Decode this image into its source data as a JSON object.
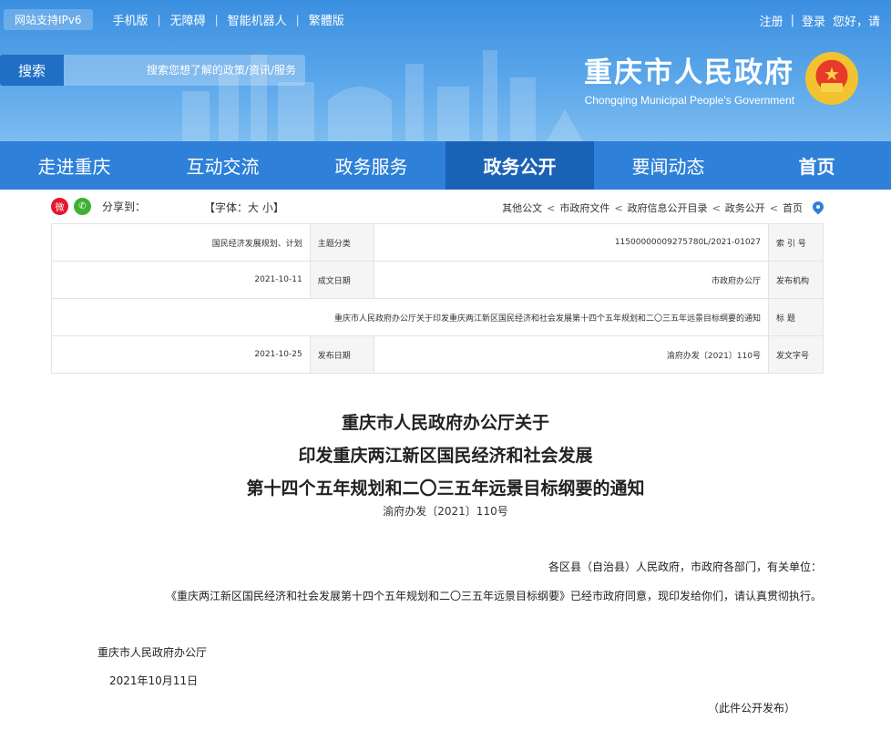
{
  "topbar": {
    "ipv6": "网站支持IPv6",
    "links": [
      "手机版",
      "无障碍",
      "智能机器人",
      "繁體版"
    ],
    "greeting": "您好，请",
    "login": "登录",
    "register": "注册"
  },
  "search": {
    "button": "搜索",
    "placeholder": "搜索您想了解的政策/资讯/服务"
  },
  "logo": {
    "title": "重庆市人民政府",
    "subtitle": "Chongqing Municipal People's Government"
  },
  "nav": {
    "items": [
      "首页",
      "要闻动态",
      "政务公开",
      "政务服务",
      "互动交流",
      "走进重庆"
    ]
  },
  "share": {
    "label": "分享到：",
    "font_size": "【字体：",
    "font_small": "小",
    "font_large": "大",
    "font_close": "】"
  },
  "breadcrumb": [
    "首页",
    "政务公开",
    "政府信息公开目录",
    "市政府文件",
    "其他公文"
  ],
  "meta": {
    "index_label": "索 引 号",
    "index_value": "11500000009275780L/2021-01027",
    "category_label": "主题分类",
    "category_value": "国民经济发展规划、计划",
    "issuer_label": "发布机构",
    "issuer_value": "市政府办公厅",
    "written_label": "成文日期",
    "written_value": "2021-10-11",
    "title_label": "标 题",
    "title_value": "重庆市人民政府办公厅关于印发重庆两江新区国民经济和社会发展第十四个五年规划和二〇三五年远景目标纲要的通知",
    "docno_label": "发文字号",
    "docno_value": "渝府办发〔2021〕110号",
    "published_label": "发布日期",
    "published_value": "2021-10-25"
  },
  "document": {
    "title_line1": "重庆市人民政府办公厅关于",
    "title_line2": "印发重庆两江新区国民经济和社会发展",
    "title_line3": "第十四个五年规划和二〇三五年远景目标纲要的通知",
    "number": "渝府办发〔2021〕110号",
    "addressee": "各区县（自治县）人民政府，市政府各部门，有关单位：",
    "body": "《重庆两江新区国民经济和社会发展第十四个五年规划和二〇三五年远景目标纲要》已经市政府同意，现印发给你们，请认真贯彻执行。",
    "signature": "重庆市人民政府办公厅",
    "date": "2021年10月11日",
    "note": "（此件公开发布）"
  }
}
